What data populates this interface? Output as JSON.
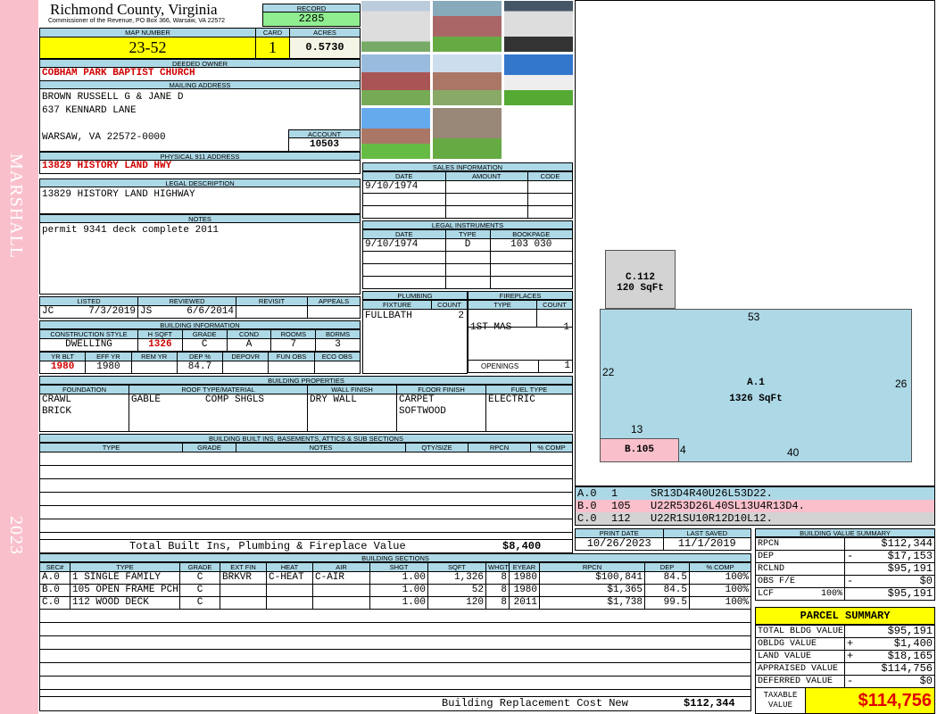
{
  "side": {
    "district": "MARSHALL",
    "year": "2023"
  },
  "header": {
    "title": "Richmond County, Virginia",
    "subtitle": "Commissioner of the Revenue, PO Box 366, Warsaw, VA 22572",
    "record_label": "RECORD",
    "record": "2285"
  },
  "map": {
    "map_label": "MAP NUMBER",
    "map": "23-52",
    "card_label": "CARD",
    "card": "1",
    "acres_label": "ACRES",
    "acres": "0.5730"
  },
  "owner": {
    "label": "DEEDED OWNER",
    "value": "COBHAM PARK BAPTIST CHURCH"
  },
  "mailing": {
    "label": "MAILING ADDRESS",
    "lines": [
      "BROWN RUSSELL G & JANE D",
      "637 KENNARD LANE",
      "WARSAW, VA 22572-0000"
    ],
    "account_label": "ACCOUNT",
    "account": "10503"
  },
  "physical": {
    "label": "PHYSICAL 911 ADDRESS",
    "value": "13829 HISTORY LAND HWY"
  },
  "legal": {
    "label": "LEGAL DESCRIPTION",
    "value": "13829 HISTORY LAND HIGHWAY"
  },
  "notes": {
    "label": "NOTES",
    "value": "permit 9341 deck complete 2011"
  },
  "review": {
    "listed_label": "LISTED",
    "listed_by": "JC",
    "listed_date": "7/3/2019",
    "reviewed_label": "REVIEWED",
    "reviewed_by": "JS",
    "reviewed_date": "6/6/2014",
    "revisit_label": "REVISIT",
    "appeals_label": "APPEALS"
  },
  "bldg_info": {
    "label": "BUILDING INFORMATION",
    "h1": [
      "CONSTRUCTION STYLE",
      "H SQFT",
      "GRADE",
      "COND",
      "ROOMS",
      "BDRMS"
    ],
    "v1": [
      "DWELLING",
      "1326",
      "C",
      "A",
      "7",
      "3"
    ],
    "h2": [
      "YR BLT",
      "EFF YR",
      "REM YR",
      "DEP %",
      "DEPOVR",
      "FUN OBS",
      "ECO OBS"
    ],
    "v2": [
      "1980",
      "1980",
      "",
      "84.7",
      "",
      "",
      ""
    ]
  },
  "bldg_props": {
    "label": "BUILDING PROPERTIES",
    "heads": [
      "FOUNDATION",
      "ROOF TYPE/MATERIAL",
      "WALL FINISH",
      "FLOOR FINISH",
      "FUEL TYPE"
    ],
    "foundation": [
      "CRAWL",
      "BRICK"
    ],
    "roof_type": "GABLE",
    "roof_mat": "COMP SHGLS",
    "wall": "DRY WALL",
    "floor": [
      "CARPET",
      "SOFTWOOD"
    ],
    "fuel": "ELECTRIC"
  },
  "builtins": {
    "label": "BUILDING BUILT INS, BASEMENTS, ATTICS & SUB SECTIONS",
    "heads": [
      "TYPE",
      "GRADE",
      "NOTES",
      "QTY/SIZE",
      "RPCN",
      "% COMP"
    ],
    "total_label": "Total Built Ins, Plumbing & Fireplace Value",
    "total": "$8,400"
  },
  "sales": {
    "label": "SALES INFORMATION",
    "heads": [
      "DATE",
      "AMOUNT",
      "CODE"
    ],
    "rows": [
      [
        "9/10/1974",
        "",
        ""
      ]
    ]
  },
  "instruments": {
    "label": "LEGAL INSTRUMENTS",
    "heads": [
      "DATE",
      "TYPE",
      "BOOKPAGE"
    ],
    "rows": [
      [
        "9/10/1974",
        "D",
        "103 030"
      ]
    ]
  },
  "plumbing": {
    "label": "PLUMBING",
    "heads": [
      "FIXTURE",
      "COUNT"
    ],
    "rows": [
      [
        "FULLBATH",
        "2"
      ]
    ]
  },
  "fireplaces": {
    "label": "FIREPLACES",
    "heads": [
      "TYPE",
      "COUNT"
    ],
    "rows": [
      [
        "1ST MAS",
        "1"
      ]
    ],
    "openings_label": "OPENINGS",
    "openings": "1"
  },
  "sketch": {
    "a_label": "A.1",
    "a_sqft": "1326 SqFt",
    "b_label": "B.105",
    "c_label": "C.112",
    "c_sqft": "120 SqFt",
    "dims": {
      "top": "53",
      "left": "22",
      "right": "26",
      "bottom": "40",
      "b_top": "13",
      "b_right": "4"
    }
  },
  "sketch_codes": [
    {
      "sec": "A.0",
      "code": "1",
      "vector": "SR13D4R40U26L53D22."
    },
    {
      "sec": "B.0",
      "code": "105",
      "vector": "U22R53D26L40SL13U4R13D4."
    },
    {
      "sec": "C.0",
      "code": "112",
      "vector": "U22R1SU10R12D10L12."
    }
  ],
  "dates": {
    "print_label": "PRINT DATE",
    "print": "10/26/2023",
    "saved_label": "LAST SAVED",
    "saved": "11/1/2019"
  },
  "sections": {
    "label": "BUILDING SECTIONS",
    "heads": [
      "SEC#",
      "TYPE",
      "GRADE",
      "EXT FIN",
      "HEAT",
      "AIR",
      "SHGT",
      "SQFT",
      "WHGT",
      "EYEAR",
      "RPCN",
      "DEP",
      "% COMP"
    ],
    "rows": [
      [
        "A.0",
        "1 SINGLE FAMILY",
        "C",
        "BRKVR",
        "C-HEAT",
        "C-AIR",
        "1.00",
        "1,326",
        "8",
        "1980",
        "$100,841",
        "84.5",
        "100%"
      ],
      [
        "B.0",
        "105 OPEN FRAME PCH",
        "C",
        "",
        "",
        "",
        "1.00",
        "52",
        "8",
        "1980",
        "$1,365",
        "84.5",
        "100%"
      ],
      [
        "C.0",
        "112 WOOD DECK",
        "C",
        "",
        "",
        "",
        "1.00",
        "120",
        "8",
        "2011",
        "$1,738",
        "99.5",
        "100%"
      ]
    ],
    "total_label": "Building Replacement Cost New",
    "total": "$112,344"
  },
  "value_summary": {
    "label": "BUILDING VALUE SUMMARY",
    "rows": [
      [
        "RPCN",
        "",
        "",
        "$112,344"
      ],
      [
        "DEP",
        "",
        "-",
        "$17,153"
      ],
      [
        "RCLND",
        "",
        "",
        "$95,191"
      ],
      [
        "OBS F/E",
        "",
        "-",
        "$0"
      ],
      [
        "LCF",
        "100%",
        "",
        "$95,191"
      ]
    ]
  },
  "parcel": {
    "label": "PARCEL SUMMARY",
    "rows": [
      [
        "TOTAL BLDG VALUE",
        "",
        "$95,191"
      ],
      [
        "OBLDG VALUE",
        "+",
        "$1,400"
      ],
      [
        "LAND VALUE",
        "+",
        "$18,165"
      ],
      [
        "APPRAISED VALUE",
        "",
        "$114,756"
      ],
      [
        "DEFERRED VALUE",
        "-",
        "$0"
      ]
    ],
    "taxable_label1": "TAXABLE",
    "taxable_label2": "VALUE",
    "taxable": "$114,756"
  },
  "colors": {
    "header": "#add8e6",
    "yellow": "#ffff00",
    "record": "#90ee90",
    "pink": "#f9c0cc",
    "red": "#d00000"
  }
}
